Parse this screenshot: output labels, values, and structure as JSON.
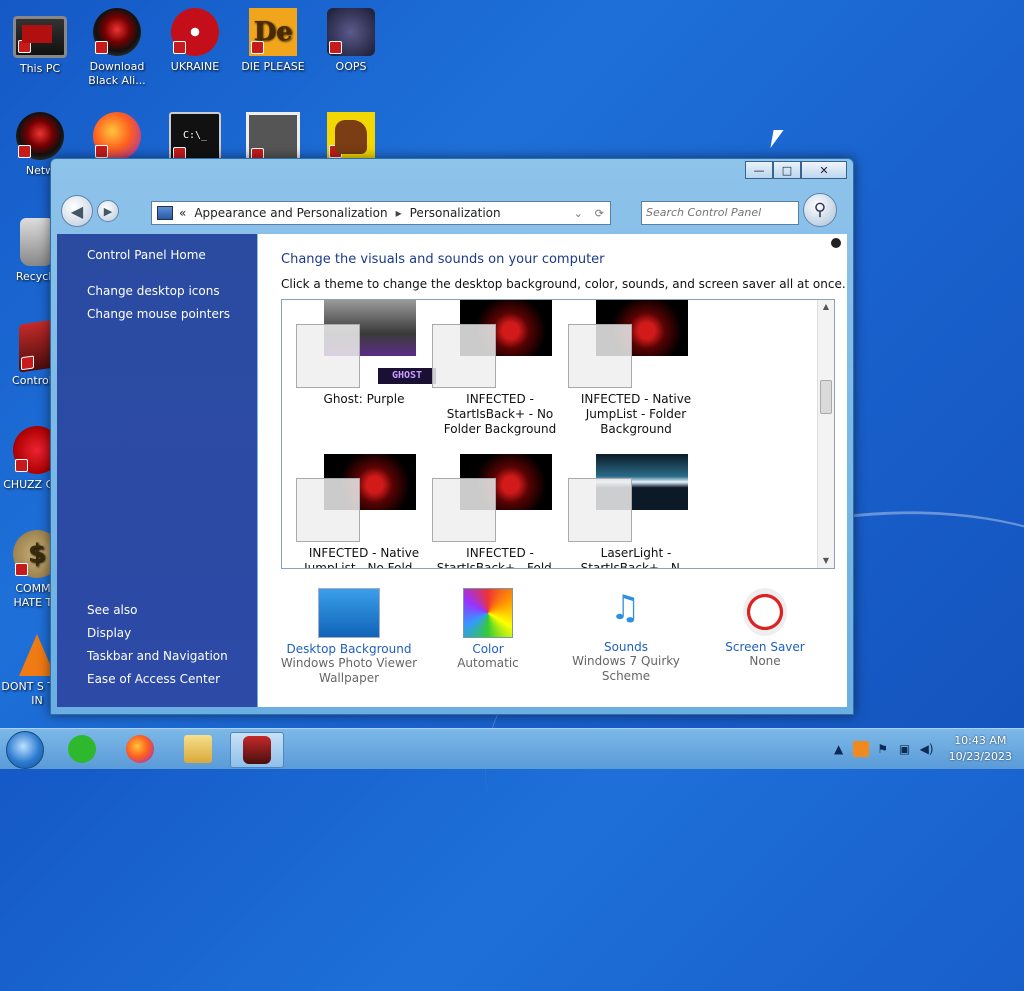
{
  "desktop": {
    "icons": [
      {
        "label": "This PC",
        "icon": "computer-icon"
      },
      {
        "label": "Download Black Ali...",
        "icon": "alien-icon"
      },
      {
        "label": "UKRAINE",
        "icon": "radiation-icon"
      },
      {
        "label": "DIE PLEASE",
        "icon": "die-icon"
      },
      {
        "label": "OOPS",
        "icon": "oops-icon"
      },
      {
        "label": "Netw",
        "icon": "network-icon"
      },
      {
        "label": "Recycle",
        "icon": "recycle-bin-icon"
      },
      {
        "label": "Control P",
        "icon": "control-panel-icon"
      },
      {
        "label": "CHUZZ CUM",
        "icon": "chuzzle-icon"
      },
      {
        "label": "COMMU HATE TH",
        "icon": "money-bag-icon"
      },
      {
        "label": "DONT S THIS IN",
        "icon": "traffic-cone-icon"
      }
    ],
    "die_glyph": "De",
    "money_glyph": "$",
    "term_glyph": "C:\\_"
  },
  "window": {
    "controls": {
      "minimize": "—",
      "maximize": "□",
      "close": "✕"
    },
    "address": {
      "prefix": "«",
      "crumb1": "Appearance and Personalization",
      "separator": "▸",
      "crumb2": "Personalization"
    },
    "search_placeholder": "Search Control Panel",
    "sidebar": {
      "home": "Control Panel Home",
      "link1": "Change desktop icons",
      "link2": "Change mouse pointers",
      "see_also": "See also",
      "display": "Display",
      "taskbar": "Taskbar and Navigation",
      "ease": "Ease of Access Center"
    },
    "content": {
      "title": "Change the visuals and sounds on your computer",
      "description": "Click a theme to change the desktop background, color, sounds, and screen saver all at once.",
      "ghost_logo": "GHOST",
      "themes": [
        {
          "name": "Ghost: Purple"
        },
        {
          "name": "INFECTED - StartIsBack+ - No Folder Background"
        },
        {
          "name": "INFECTED - Native JumpList - Folder Background"
        },
        {
          "name": "INFECTED - Native JumpList - No Fold..."
        },
        {
          "name": "INFECTED - StartIsBack+ - Fold..."
        },
        {
          "name": "LaserLight - StartIsBack+ - N..."
        }
      ],
      "bottom": [
        {
          "label": "Desktop Background",
          "sub": "Windows Photo Viewer Wallpaper"
        },
        {
          "label": "Color",
          "sub": "Automatic"
        },
        {
          "label": "Sounds",
          "sub": "Windows 7 Quirky Scheme"
        },
        {
          "label": "Screen Saver",
          "sub": "None"
        }
      ]
    }
  },
  "taskbar": {
    "time": "10:43 AM",
    "date": "10/23/2023"
  }
}
